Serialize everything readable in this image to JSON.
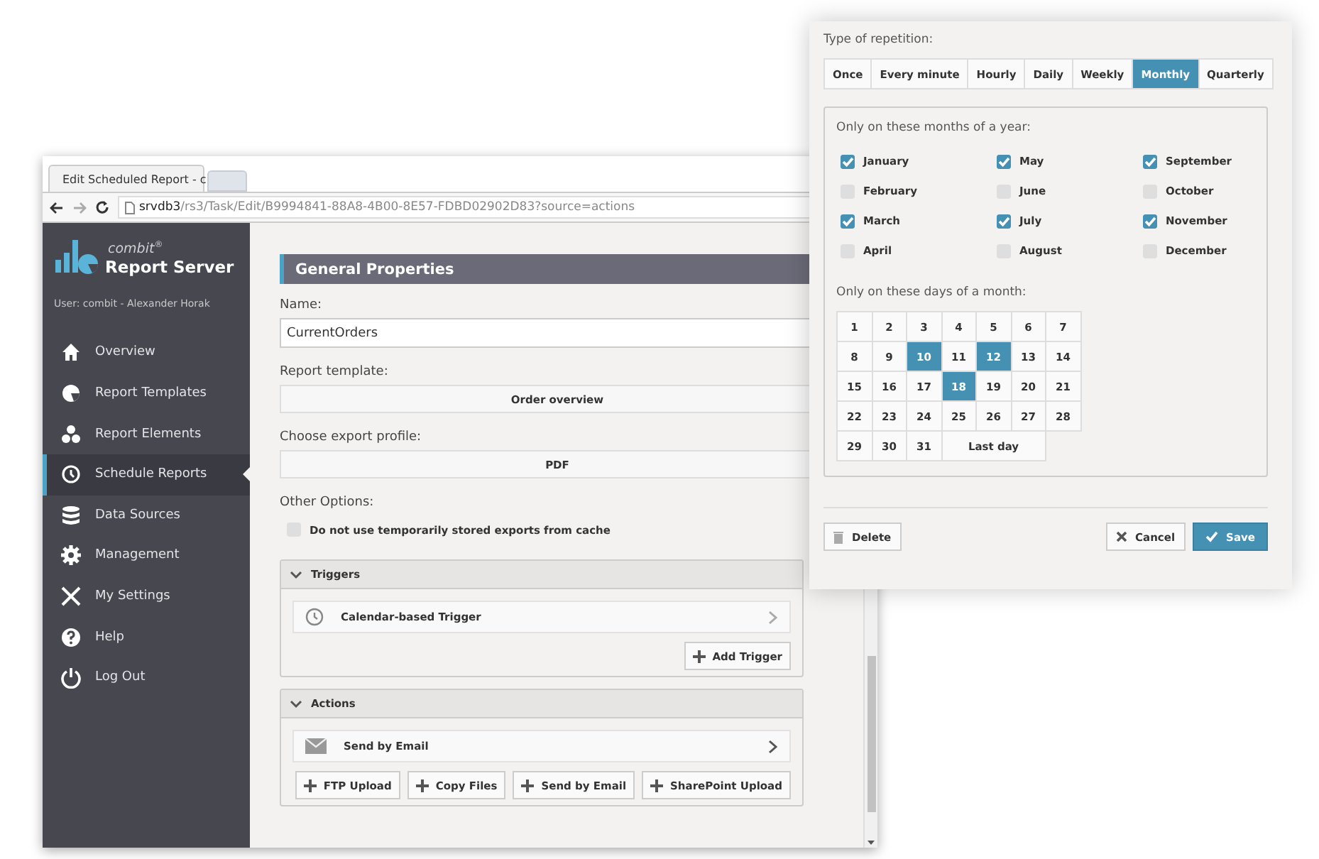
{
  "browser": {
    "tab_title": "Edit Scheduled Report - c",
    "url_host": "srvdb3",
    "url_path": "/rs3/Task/Edit/B9994841-88A8-4B00-8E57-FDBD02902D83?source=actions"
  },
  "sidebar": {
    "brand_small": "combit$^{®}$",
    "brand": "Report Server",
    "user": "User: combit - Alexander Horak",
    "items": [
      {
        "label": "Overview",
        "selected": false
      },
      {
        "label": "Report Templates",
        "selected": false
      },
      {
        "label": "Report Elements",
        "selected": false
      },
      {
        "label": "Schedule Reports",
        "selected": true
      },
      {
        "label": "Data Sources",
        "selected": false
      },
      {
        "label": "Management",
        "selected": false
      },
      {
        "label": "My Settings",
        "selected": false
      },
      {
        "label": "Help",
        "selected": false
      },
      {
        "label": "Log Out",
        "selected": false
      }
    ]
  },
  "main": {
    "section_title": "General Properties",
    "fields": [
      {
        "kind": "input",
        "label": "Name:",
        "value": "CurrentOrders"
      },
      {
        "kind": "select",
        "label": "Report template:",
        "value": "Order overview"
      },
      {
        "kind": "select",
        "label": "Choose export profile:",
        "value": "PDF"
      }
    ],
    "other_options_label": "Other Options:",
    "cache_option": {
      "label": "Do not use temporarily stored exports from cache",
      "checked": false
    },
    "panels": [
      {
        "title": "Triggers",
        "expanded": true,
        "items": [
          {
            "kind": "clock",
            "label": "Calendar-based Trigger"
          }
        ],
        "buttons": [
          "Add Trigger"
        ]
      },
      {
        "title": "Actions",
        "expanded": true,
        "items": [
          {
            "kind": "mail",
            "label": "Send by Email"
          }
        ],
        "buttons": [
          "FTP Upload",
          "Copy Files",
          "Send by Email",
          "SharePoint Upload"
        ]
      }
    ]
  },
  "popup": {
    "repetition_label": "Type of repetition:",
    "repetition_types": [
      {
        "label": "Once",
        "selected": false
      },
      {
        "label": "Every minute",
        "selected": false
      },
      {
        "label": "Hourly",
        "selected": false
      },
      {
        "label": "Daily",
        "selected": false
      },
      {
        "label": "Weekly",
        "selected": false
      },
      {
        "label": "Monthly",
        "selected": true
      },
      {
        "label": "Quarterly",
        "selected": false
      }
    ],
    "months_label": "Only on these months of a year:",
    "months": [
      {
        "label": "January",
        "checked": true
      },
      {
        "label": "February",
        "checked": false
      },
      {
        "label": "March",
        "checked": true
      },
      {
        "label": "April",
        "checked": false
      },
      {
        "label": "May",
        "checked": true
      },
      {
        "label": "June",
        "checked": false
      },
      {
        "label": "July",
        "checked": true
      },
      {
        "label": "August",
        "checked": false
      },
      {
        "label": "September",
        "checked": true
      },
      {
        "label": "October",
        "checked": false
      },
      {
        "label": "November",
        "checked": true
      },
      {
        "label": "December",
        "checked": false
      }
    ],
    "days_label": "Only on these days of a month:",
    "days": [
      {
        "kind": "day",
        "label": "1",
        "selected": false
      },
      {
        "kind": "day",
        "label": "2",
        "selected": false
      },
      {
        "kind": "day",
        "label": "3",
        "selected": false
      },
      {
        "kind": "day",
        "label": "4",
        "selected": false
      },
      {
        "kind": "day",
        "label": "5",
        "selected": false
      },
      {
        "kind": "day",
        "label": "6",
        "selected": false
      },
      {
        "kind": "day",
        "label": "7",
        "selected": false
      },
      {
        "kind": "day",
        "label": "8",
        "selected": false
      },
      {
        "kind": "day",
        "label": "9",
        "selected": false
      },
      {
        "kind": "day",
        "label": "10",
        "selected": true
      },
      {
        "kind": "day",
        "label": "11",
        "selected": false
      },
      {
        "kind": "day",
        "label": "12",
        "selected": true
      },
      {
        "kind": "day",
        "label": "13",
        "selected": false
      },
      {
        "kind": "day",
        "label": "14",
        "selected": false
      },
      {
        "kind": "day",
        "label": "15",
        "selected": false
      },
      {
        "kind": "day",
        "label": "16",
        "selected": false
      },
      {
        "kind": "day",
        "label": "17",
        "selected": false
      },
      {
        "kind": "day",
        "label": "18",
        "selected": true
      },
      {
        "kind": "day",
        "label": "19",
        "selected": false
      },
      {
        "kind": "day",
        "label": "20",
        "selected": false
      },
      {
        "kind": "day",
        "label": "21",
        "selected": false
      },
      {
        "kind": "day",
        "label": "22",
        "selected": false
      },
      {
        "kind": "day",
        "label": "23",
        "selected": false
      },
      {
        "kind": "day",
        "label": "24",
        "selected": false
      },
      {
        "kind": "day",
        "label": "25",
        "selected": false
      },
      {
        "kind": "day",
        "label": "26",
        "selected": false
      },
      {
        "kind": "day",
        "label": "27",
        "selected": false
      },
      {
        "kind": "day",
        "label": "28",
        "selected": false
      },
      {
        "kind": "day",
        "label": "29",
        "selected": false
      },
      {
        "kind": "day",
        "label": "30",
        "selected": false
      },
      {
        "kind": "day",
        "label": "31",
        "selected": false
      },
      {
        "kind": "wide",
        "label": "Last day",
        "selected": false
      }
    ],
    "delete_button": "Delete",
    "cancel_button": "Cancel",
    "save_button": "Save"
  }
}
